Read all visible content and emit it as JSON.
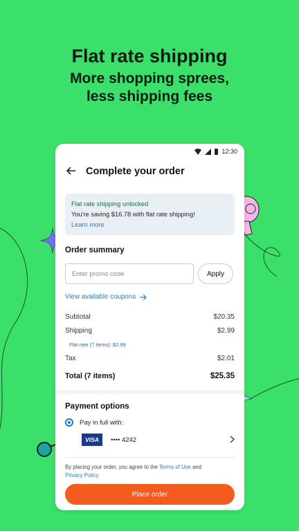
{
  "headline": {
    "title": "Flat rate shipping",
    "subtitle_line1": "More shopping sprees,",
    "subtitle_line2": "less shipping fees"
  },
  "status_bar": {
    "time": "12:30"
  },
  "topbar": {
    "back_icon": "arrow-left",
    "title": "Complete your order"
  },
  "banner": {
    "title": "Flat rate shipping unlocked",
    "message": "You're saving $16.78 with flat rate shipping!",
    "link": "Learn more"
  },
  "order_summary": {
    "title": "Order summary",
    "promo_placeholder": "Enter promo code",
    "apply_label": "Apply",
    "coupons_link": "View available coupons",
    "subtotal_label": "Subtotal",
    "subtotal_value": "$20.35",
    "shipping_label": "Shipping",
    "shipping_value": "$2.99",
    "shipping_note": "Flat rate (7 items): $2.99",
    "tax_label": "Tax",
    "tax_value": "$2.01",
    "total_label": "Total (7 items)",
    "total_value": "$25.35"
  },
  "payment": {
    "title": "Payment options",
    "pay_in_full": "Pay in full with:",
    "card_brand": "VISA",
    "card_number": "•••• 4242"
  },
  "legal": {
    "prefix": "By placing your order, you agree to the ",
    "terms": "Terms of Use",
    "and": " and ",
    "privacy": "Privacy Policy"
  },
  "place_order_label": "Place order",
  "colors": {
    "background": "#3be06a",
    "accent": "#f45b1f",
    "link": "#2a7cc1"
  }
}
